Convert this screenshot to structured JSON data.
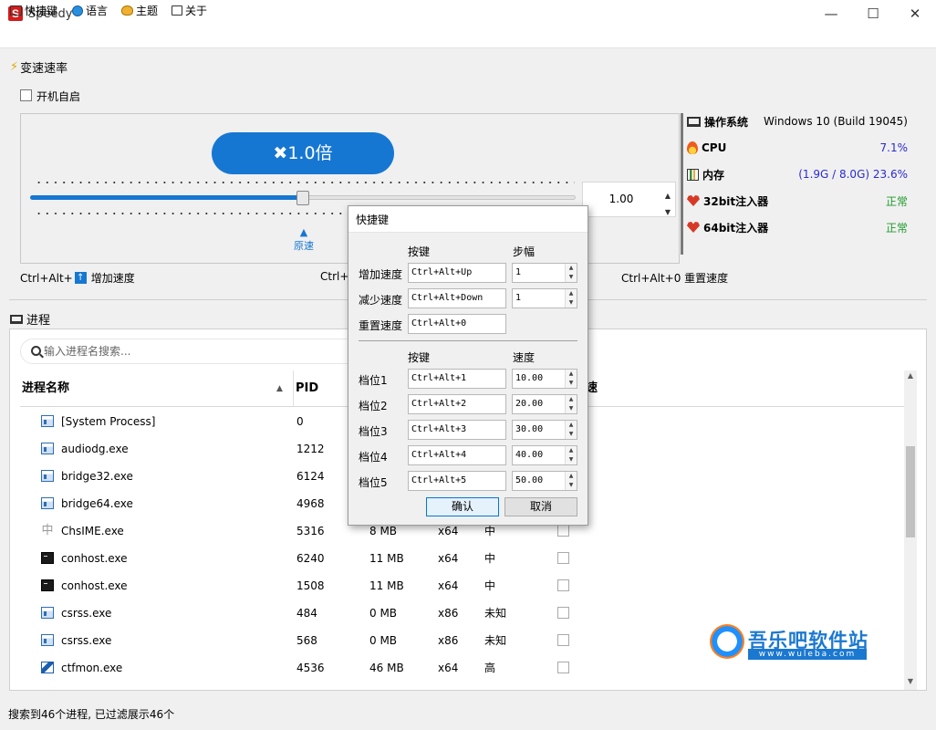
{
  "app": {
    "title": "Speedy",
    "logo_letter": "S",
    "minimize": "—",
    "maximize": "☐",
    "close": "✕"
  },
  "menu": {
    "items": [
      "快捷键",
      "语言",
      "主题",
      "关于"
    ]
  },
  "speed_section": {
    "title": "变速速率",
    "autostart_label": "开机自启",
    "speed_badge": "✖1.0倍",
    "spin_value": "1.00",
    "spin_up": "▲",
    "spin_down": "▼",
    "original_marker": "▲",
    "original_label": "原速",
    "slider_level_fraction": 0.5,
    "hotkey_increase_prefix": "Ctrl+Alt+",
    "hotkey_increase_label": "增加速度",
    "hotkey_decrease_prefix": "Ctrl+Al",
    "hotkey_reset_label": "Ctrl+Alt+0 重置速度"
  },
  "sysinfo": {
    "rows": [
      {
        "label": "操作系统",
        "value": "Windows 10 (Build 19045)",
        "value_color": "#000000",
        "icon": "monitor-icon"
      },
      {
        "label": "CPU",
        "value": "7.1%",
        "value_color": "#2a2ad4",
        "icon": "flame-icon"
      },
      {
        "label": "内存",
        "value": "(1.9G / 8.0G) 23.6%",
        "value_color": "#2a2ad4",
        "icon": "chart-icon"
      },
      {
        "label": "32bit注入器",
        "value": "正常",
        "value_color": "#1f9a2e",
        "icon": "heart-icon"
      },
      {
        "label": "64bit注入器",
        "value": "正常",
        "value_color": "#1f9a2e",
        "icon": "heart-icon"
      }
    ]
  },
  "process_section": {
    "title": "进程",
    "search_placeholder": "输入进程名搜索...",
    "columns": [
      "进程名称",
      "PID",
      "",
      "",
      "",
      "速"
    ],
    "sort_indicator": "▲",
    "rows": [
      {
        "name": "[System Process]",
        "pid": "0",
        "mem": "",
        "arch": "",
        "priority": "",
        "icon": "window-icon"
      },
      {
        "name": "audiodg.exe",
        "pid": "1212",
        "mem": "",
        "arch": "",
        "priority": "",
        "icon": "window-icon"
      },
      {
        "name": "bridge32.exe",
        "pid": "6124",
        "mem": "",
        "arch": "",
        "priority": "",
        "icon": "window-icon"
      },
      {
        "name": "bridge64.exe",
        "pid": "4968",
        "mem": "",
        "arch": "",
        "priority": "",
        "icon": "window-icon"
      },
      {
        "name": "ChsIME.exe",
        "pid": "5316",
        "mem": "8 MB",
        "arch": "x64",
        "priority": "中",
        "icon": "ime-icon"
      },
      {
        "name": "conhost.exe",
        "pid": "6240",
        "mem": "11 MB",
        "arch": "x64",
        "priority": "中",
        "icon": "console-icon"
      },
      {
        "name": "conhost.exe",
        "pid": "1508",
        "mem": "11 MB",
        "arch": "x64",
        "priority": "中",
        "icon": "console-icon"
      },
      {
        "name": "csrss.exe",
        "pid": "484",
        "mem": "0 MB",
        "arch": "x86",
        "priority": "未知",
        "icon": "window-icon"
      },
      {
        "name": "csrss.exe",
        "pid": "568",
        "mem": "0 MB",
        "arch": "x86",
        "priority": "未知",
        "icon": "window-icon"
      },
      {
        "name": "ctfmon.exe",
        "pid": "4536",
        "mem": "46 MB",
        "arch": "x64",
        "priority": "高",
        "icon": "pen-icon"
      }
    ]
  },
  "status_bar": "搜索到46个进程, 已过滤展示46个",
  "watermark": {
    "text": "吾乐吧软件站",
    "url": "www.wuleba.com"
  },
  "hotkey_dialog": {
    "title": "快捷键",
    "header_key": "按键",
    "header_step": "步幅",
    "rows": [
      {
        "label": "增加速度",
        "key": "Ctrl+Alt+Up",
        "step": "1"
      },
      {
        "label": "减少速度",
        "key": "Ctrl+Alt+Down",
        "step": "1"
      },
      {
        "label": "重置速度",
        "key": "Ctrl+Alt+0"
      }
    ],
    "header_key2": "按键",
    "header_speed": "速度",
    "gears": [
      {
        "label": "档位1",
        "key": "Ctrl+Alt+1",
        "speed": "10.00"
      },
      {
        "label": "档位2",
        "key": "Ctrl+Alt+2",
        "speed": "20.00"
      },
      {
        "label": "档位3",
        "key": "Ctrl+Alt+3",
        "speed": "30.00"
      },
      {
        "label": "档位4",
        "key": "Ctrl+Alt+4",
        "speed": "40.00"
      },
      {
        "label": "档位5",
        "key": "Ctrl+Alt+5",
        "speed": "50.00"
      }
    ],
    "confirm": "确认",
    "cancel": "取消"
  }
}
